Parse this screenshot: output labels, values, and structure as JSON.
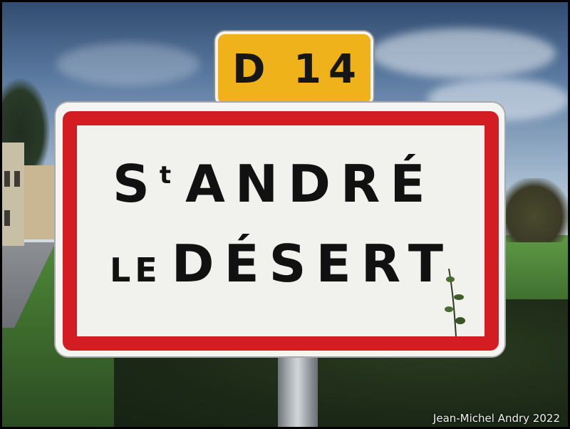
{
  "route_plate": {
    "text": "D 14",
    "color": "#f0b21a"
  },
  "sign": {
    "line1_main": "S",
    "line1_sup": "t",
    "line1_rest": "ANDRÉ",
    "line2_small": "LE",
    "line2_main": "DÉSERT",
    "border_color": "#d31d22",
    "background_color": "#f1f1ee"
  },
  "credit": "Jean-Michel Andry 2022"
}
